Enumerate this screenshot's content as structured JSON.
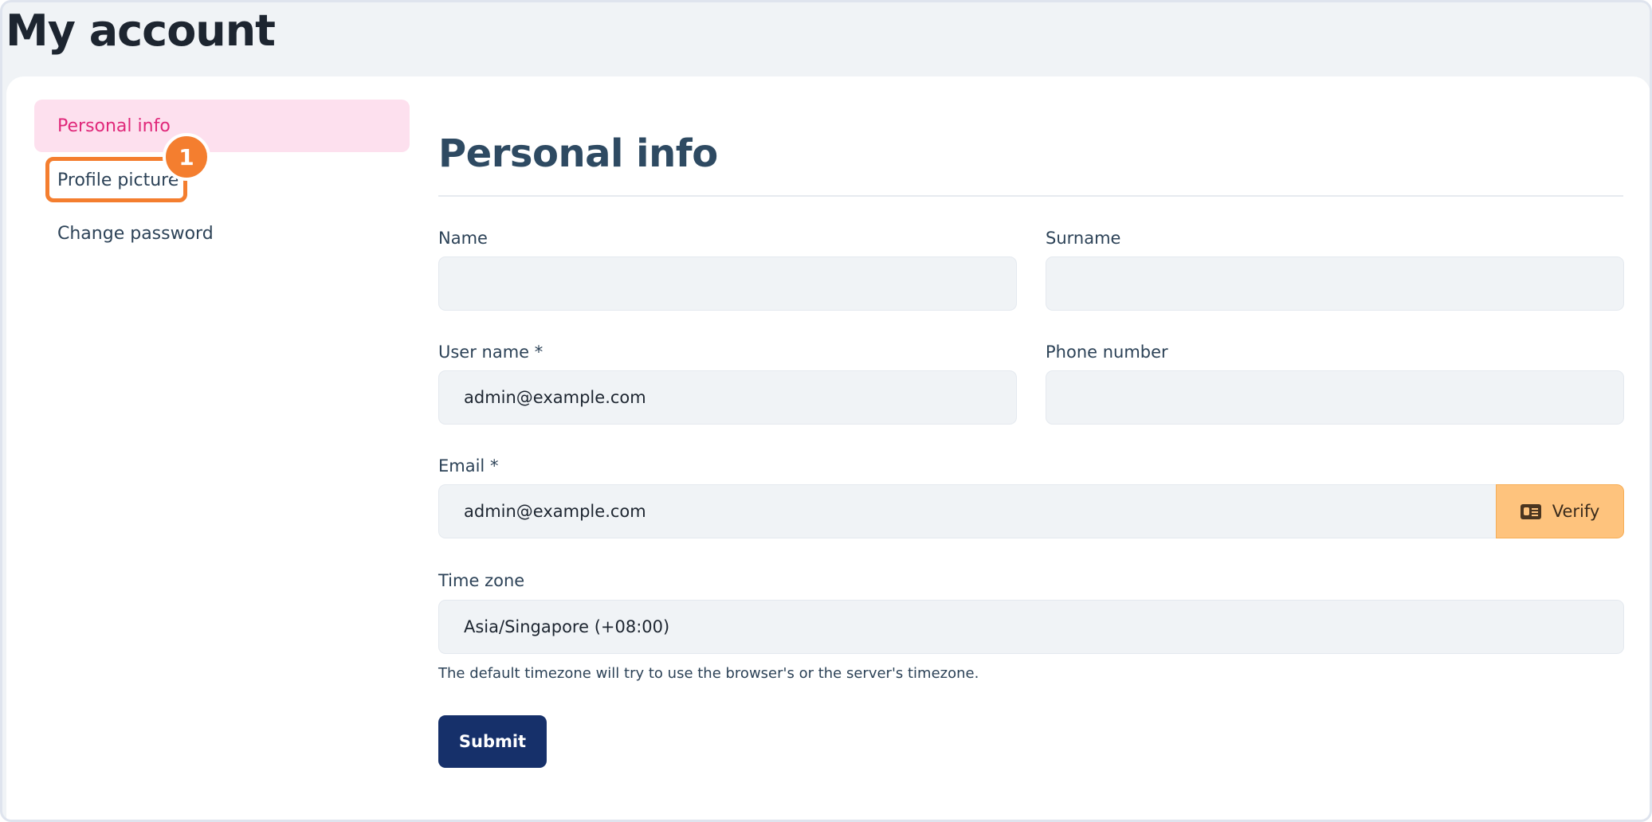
{
  "page": {
    "title": "My account"
  },
  "sidebar": {
    "items": [
      {
        "label": "Personal info",
        "active": true
      },
      {
        "label": "Profile picture",
        "active": false
      },
      {
        "label": "Change password",
        "active": false
      }
    ],
    "step_badge": "1"
  },
  "form": {
    "title": "Personal info",
    "name": {
      "label": "Name",
      "value": ""
    },
    "surname": {
      "label": "Surname",
      "value": ""
    },
    "username": {
      "label": "User name *",
      "value": "admin@example.com"
    },
    "phone": {
      "label": "Phone number",
      "value": ""
    },
    "email": {
      "label": "Email *",
      "value": "admin@example.com",
      "verify_label": "Verify",
      "verify_icon": "id-card-icon"
    },
    "timezone": {
      "label": "Time zone",
      "value": "Asia/Singapore (+08:00)",
      "hint": "The default timezone will try to use the browser's or the server's timezone."
    },
    "submit_label": "Submit"
  },
  "colors": {
    "active_nav_bg": "#fde0ee",
    "active_nav_text": "#e0287a",
    "highlight": "#f47e2f",
    "verify_bg": "#fec37d",
    "submit_bg": "#16306a"
  }
}
